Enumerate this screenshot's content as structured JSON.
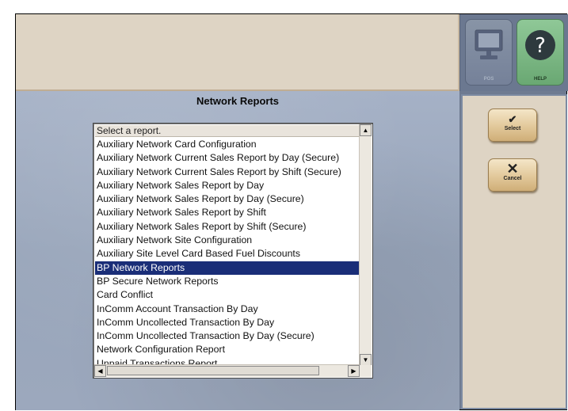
{
  "header": {
    "title": "Network Reports"
  },
  "report_list": {
    "placeholder_row": "Select a report.",
    "selected_index": 9,
    "items": [
      "Auxiliary Network Card Configuration",
      "Auxiliary Network Current Sales Report by Day (Secure)",
      "Auxiliary Network Current Sales Report by Shift (Secure)",
      "Auxiliary Network Sales Report by Day",
      "Auxiliary Network Sales Report by Day (Secure)",
      "Auxiliary Network Sales Report by Shift",
      "Auxiliary Network Sales Report by Shift (Secure)",
      "Auxiliary Network Site Configuration",
      "Auxiliary Site Level Card Based Fuel Discounts",
      "BP Network Reports",
      "BP Secure Network Reports",
      "Card Conflict",
      "InComm Account Transaction By Day",
      "InComm Uncollected Transaction By Day",
      "InComm Uncollected Transaction By Day (Secure)",
      "Network Configuration Report",
      "Unpaid Transactions Report"
    ]
  },
  "top_buttons": {
    "pos_label": "POS",
    "help_label": "HELP"
  },
  "actions": {
    "select_label": "Select",
    "select_icon": "checkmark-icon",
    "cancel_label": "Cancel",
    "cancel_icon": "x-icon"
  },
  "colors": {
    "selection": "#1a2e78",
    "action_button": "#e2c89a",
    "help_button": "#6aa873"
  }
}
